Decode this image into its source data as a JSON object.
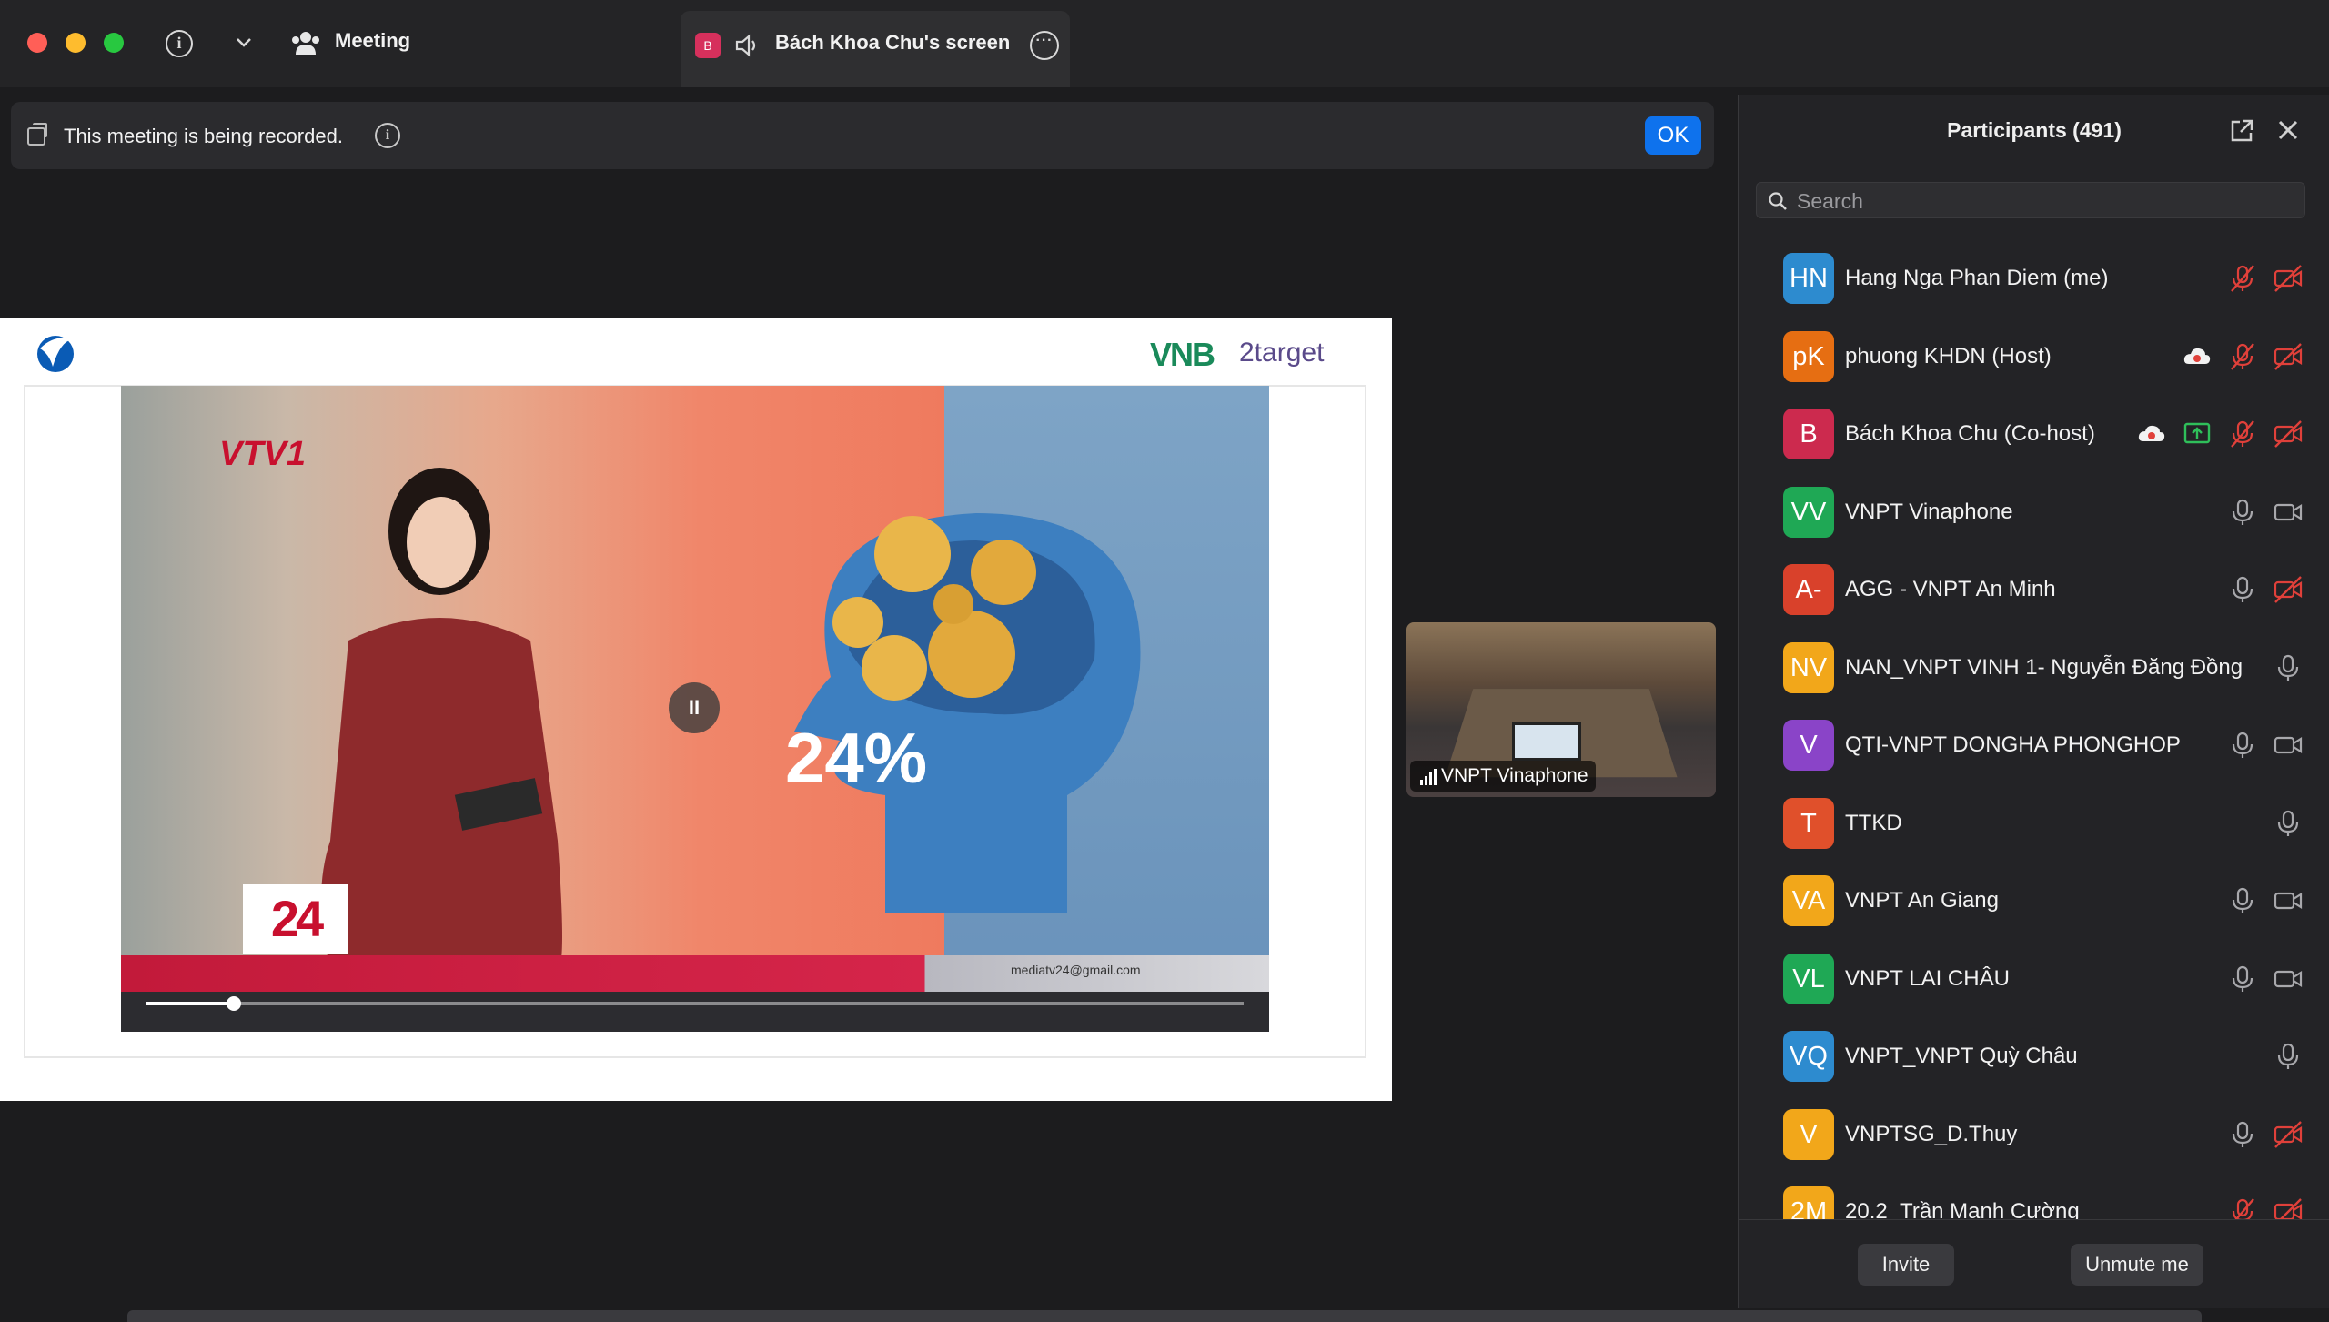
{
  "titlebar": {
    "meeting_label": "Meeting",
    "tab_badge": "B",
    "tab_title": "Bách Khoa Chu's screen",
    "tab_more": "···"
  },
  "banner": {
    "text": "This meeting is being recorded.",
    "info": "i",
    "ok_label": "OK"
  },
  "shared_screen": {
    "brand_right": "VNB",
    "brand_target": "2target",
    "vtv_logo": "VTV1",
    "channel_badge": "24",
    "percent_text": "24%",
    "email": "mediatv24@gmail.com",
    "playback_progress": 0.08
  },
  "thumbnail": {
    "label": "VNPT Vinaphone"
  },
  "participants": {
    "title": "Participants (491)",
    "search_placeholder": "Search",
    "list": [
      {
        "initials": "HN",
        "name": "Hang Nga Phan Diem (me)",
        "color": "#2d8bcf",
        "icons": [
          "mic-muted",
          "video-off"
        ]
      },
      {
        "initials": "pK",
        "name": "phuong KHDN (Host)",
        "color": "#e66e12",
        "icons": [
          "cloud-record",
          "mic-muted",
          "video-off"
        ]
      },
      {
        "initials": "B",
        "name": "Bách Khoa Chu (Co-host)",
        "color": "#cc2a4e",
        "icons": [
          "cloud-record",
          "share-screen",
          "mic-muted",
          "video-off"
        ]
      },
      {
        "initials": "VV",
        "name": "VNPT Vinaphone",
        "color": "#1fa855",
        "icons": [
          "mic",
          "video"
        ]
      },
      {
        "initials": "A-",
        "name": "AGG - VNPT An Minh",
        "color": "#d9412b",
        "icons": [
          "mic",
          "video-off"
        ]
      },
      {
        "initials": "NV",
        "name": "NAN_VNPT VINH 1- Nguyễn Đăng Đồng",
        "color": "#f2a71a",
        "icons": [
          "mic"
        ]
      },
      {
        "initials": "V",
        "name": "QTI-VNPT DONGHA PHONGHOP",
        "color": "#8a44c8",
        "icons": [
          "mic",
          "video"
        ]
      },
      {
        "initials": "T",
        "name": "TTKD",
        "color": "#e0502b",
        "icons": [
          "mic"
        ]
      },
      {
        "initials": "VA",
        "name": "VNPT An Giang",
        "color": "#f2a71a",
        "icons": [
          "mic",
          "video"
        ]
      },
      {
        "initials": "VL",
        "name": "VNPT LAI CHÂU",
        "color": "#1fa855",
        "icons": [
          "mic",
          "video"
        ]
      },
      {
        "initials": "VQ",
        "name": "VNPT_VNPT Quỳ Châu",
        "color": "#2d8bcf",
        "icons": [
          "mic"
        ]
      },
      {
        "initials": "V",
        "name": "VNPTSG_D.Thuy",
        "color": "#f2a71a",
        "icons": [
          "mic",
          "video-off"
        ]
      },
      {
        "initials": "2M",
        "name": "20.2_Trần Mạnh Cường",
        "color": "#f2a71a",
        "icons": [
          "mic-muted",
          "video-off"
        ]
      }
    ],
    "invite_label": "Invite",
    "unmute_label": "Unmute me"
  }
}
